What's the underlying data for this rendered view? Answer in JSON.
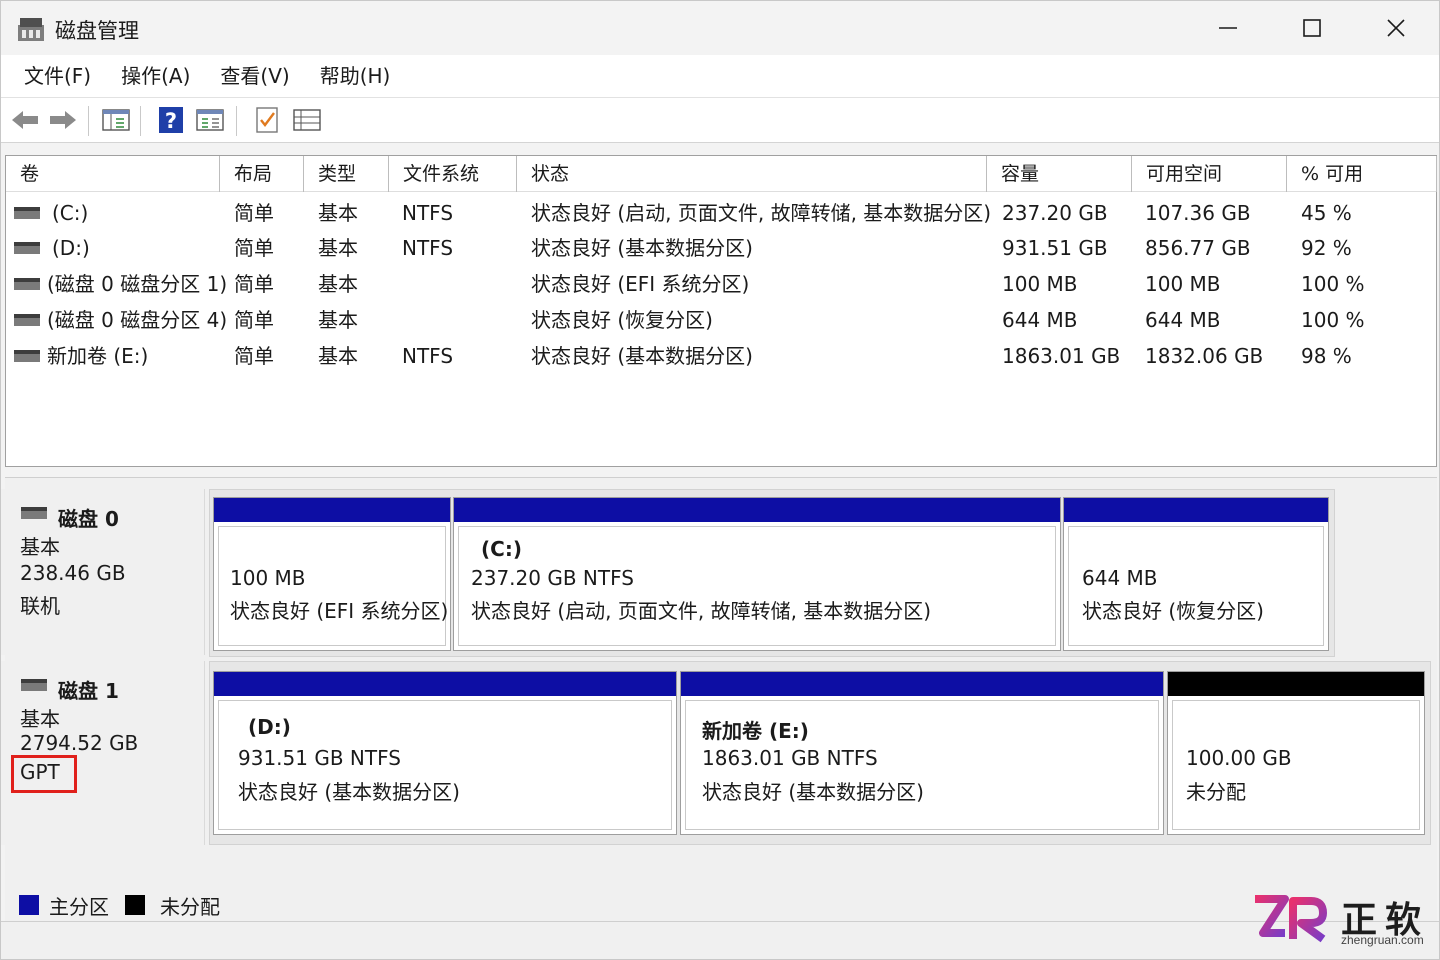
{
  "window": {
    "title": "磁盘管理"
  },
  "menu": [
    "文件(F)",
    "操作(A)",
    "查看(V)",
    "帮助(H)"
  ],
  "toolbar": {
    "icons": [
      "back-arrow-icon",
      "forward-arrow-icon",
      "console-tree-icon",
      "help-icon",
      "properties-icon",
      "checklist-icon",
      "list-view-icon"
    ]
  },
  "volume_list": {
    "columns": [
      "卷",
      "布局",
      "类型",
      "文件系统",
      "状态",
      "容量",
      "可用空间",
      "% 可用"
    ],
    "rows": [
      {
        "volume": "(C:)",
        "layout": "简单",
        "type": "基本",
        "fs": "NTFS",
        "status": "状态良好 (启动, 页面文件, 故障转储, 基本数据分区)",
        "capacity": "237.20 GB",
        "free": "107.36 GB",
        "pct": "45 %"
      },
      {
        "volume": "(D:)",
        "layout": "简单",
        "type": "基本",
        "fs": "NTFS",
        "status": "状态良好 (基本数据分区)",
        "capacity": "931.51 GB",
        "free": "856.77 GB",
        "pct": "92 %"
      },
      {
        "volume": "(磁盘 0 磁盘分区 1)",
        "layout": "简单",
        "type": "基本",
        "fs": "",
        "status": "状态良好 (EFI 系统分区)",
        "capacity": "100 MB",
        "free": "100 MB",
        "pct": "100 %"
      },
      {
        "volume": "(磁盘 0 磁盘分区 4)",
        "layout": "简单",
        "type": "基本",
        "fs": "",
        "status": "状态良好 (恢复分区)",
        "capacity": "644 MB",
        "free": "644 MB",
        "pct": "100 %"
      },
      {
        "volume": "新加卷 (E:)",
        "layout": "简单",
        "type": "基本",
        "fs": "NTFS",
        "status": "状态良好 (基本数据分区)",
        "capacity": "1863.01 GB",
        "free": "1832.06 GB",
        "pct": "98 %"
      }
    ]
  },
  "disks": [
    {
      "name": "磁盘 0",
      "kind": "基本",
      "size": "238.46 GB",
      "state": "联机",
      "partitions": [
        {
          "label": "",
          "size": "100 MB",
          "status": "状态良好 (EFI 系统分区)",
          "bar": "primary"
        },
        {
          "label": "(C:)",
          "size": "237.20 GB NTFS",
          "status": "状态良好 (启动, 页面文件, 故障转储, 基本数据分区)",
          "bar": "primary"
        },
        {
          "label": "",
          "size": "644 MB",
          "status": "状态良好 (恢复分区)",
          "bar": "primary"
        }
      ]
    },
    {
      "name": "磁盘 1",
      "kind": "基本",
      "size": "2794.52 GB",
      "state": "GPT",
      "partitions": [
        {
          "label": "(D:)",
          "size": "931.51 GB NTFS",
          "status": "状态良好 (基本数据分区)",
          "bar": "primary"
        },
        {
          "label": "新加卷 (E:)",
          "size": "1863.01 GB NTFS",
          "status": "状态良好 (基本数据分区)",
          "bar": "primary"
        },
        {
          "label": "",
          "size": "100.00 GB",
          "status": "未分配",
          "bar": "unallocated"
        }
      ]
    }
  ],
  "legend": [
    {
      "label": "主分区",
      "color": "#0d0ea4"
    },
    {
      "label": "未分配",
      "color": "#000000"
    }
  ],
  "watermark": {
    "brand": "正软",
    "url": "zhengruan.com",
    "colors": [
      "#e8316e",
      "#7a3cc6"
    ]
  }
}
